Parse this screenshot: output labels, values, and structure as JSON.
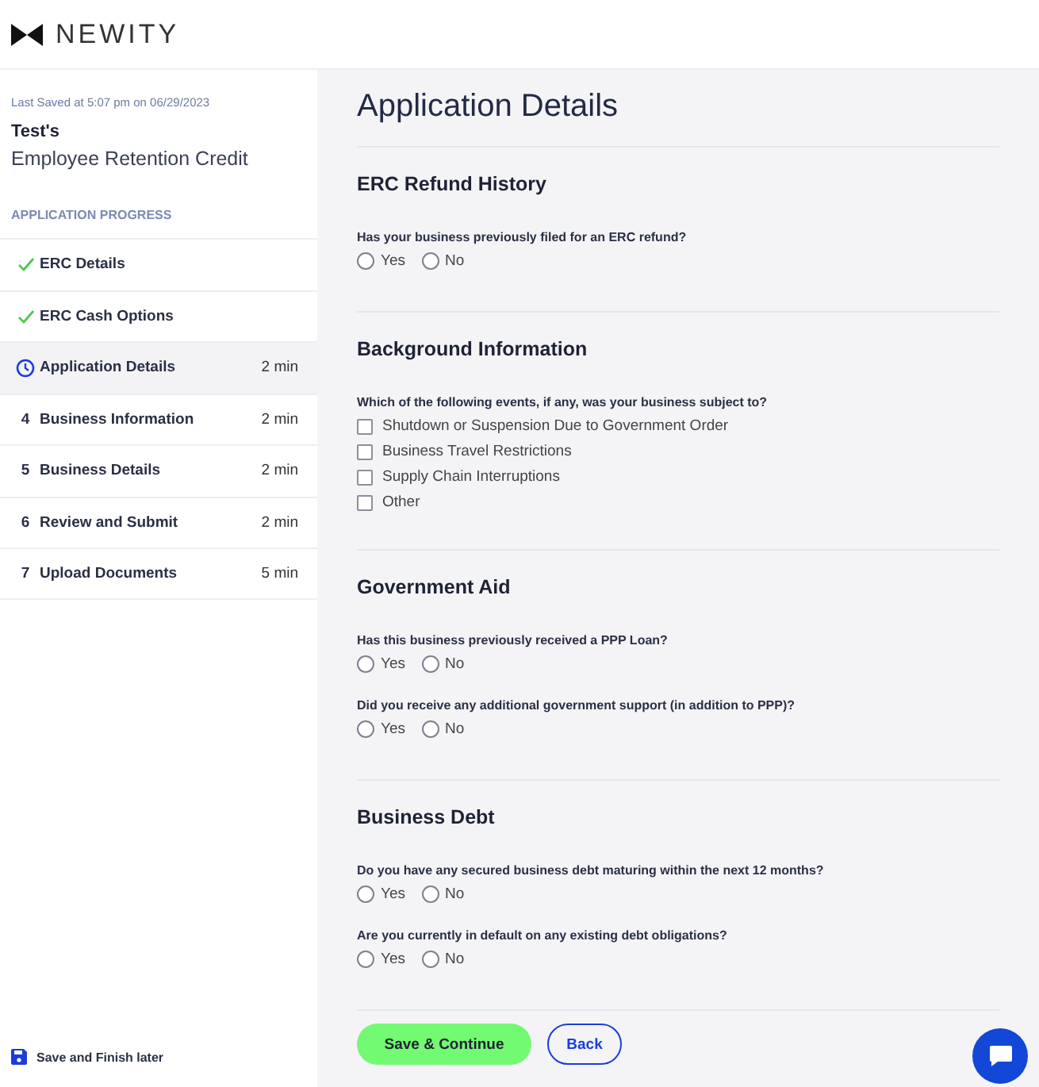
{
  "brand": "NEWITY",
  "sidebar": {
    "last_saved": "Last Saved at 5:07 pm on 06/29/2023",
    "owner": "Test's",
    "program": "Employee Retention Credit",
    "progress_heading": "APPLICATION PROGRESS",
    "steps": [
      {
        "kind": "done",
        "label": "ERC Details",
        "selected": false
      },
      {
        "kind": "done",
        "label": "ERC Cash Options",
        "selected": false
      },
      {
        "kind": "current",
        "label": "Application Details",
        "time": "2 min",
        "selected": true
      },
      {
        "kind": "todo",
        "number": "4",
        "label": "Business Information",
        "time": "2 min",
        "selected": false
      },
      {
        "kind": "todo",
        "number": "5",
        "label": "Business Details",
        "time": "2 min",
        "selected": false
      },
      {
        "kind": "todo",
        "number": "6",
        "label": "Review and Submit",
        "time": "2 min",
        "selected": false
      },
      {
        "kind": "todo",
        "number": "7",
        "label": "Upload Documents",
        "time": "5 min",
        "selected": false
      }
    ],
    "save_later": "Save and Finish later"
  },
  "page_title": "Application Details",
  "sections": [
    {
      "title": "ERC Refund History",
      "questions": [
        {
          "kind": "radio",
          "text": "Has your business previously filed for an ERC refund?",
          "options": [
            {
              "label": "Yes",
              "selected": false
            },
            {
              "label": "No",
              "selected": false
            }
          ]
        }
      ]
    },
    {
      "title": "Background Information",
      "questions": [
        {
          "kind": "checklist",
          "text": "Which of the following events, if any, was your business subject to?",
          "options": [
            {
              "label": "Shutdown or Suspension Due to Government Order",
              "checked": false
            },
            {
              "label": "Business Travel Restrictions",
              "checked": false
            },
            {
              "label": "Supply Chain Interruptions",
              "checked": false
            },
            {
              "label": "Other",
              "checked": false
            }
          ]
        }
      ]
    },
    {
      "title": "Government Aid",
      "questions": [
        {
          "kind": "radio",
          "text": "Has this business previously received a PPP Loan?",
          "options": [
            {
              "label": "Yes",
              "selected": false
            },
            {
              "label": "No",
              "selected": false
            }
          ]
        },
        {
          "kind": "radio",
          "text": "Did you receive any additional government support (in addition to PPP)?",
          "options": [
            {
              "label": "Yes",
              "selected": false
            },
            {
              "label": "No",
              "selected": false
            }
          ]
        }
      ]
    },
    {
      "title": "Business Debt",
      "questions": [
        {
          "kind": "radio",
          "text": "Do you have any secured business debt maturing within the next 12 months?",
          "options": [
            {
              "label": "Yes",
              "selected": false
            },
            {
              "label": "No",
              "selected": false
            }
          ]
        },
        {
          "kind": "radio",
          "text": "Are you currently in default on any existing debt obligations?",
          "options": [
            {
              "label": "Yes",
              "selected": false
            },
            {
              "label": "No",
              "selected": false
            }
          ]
        }
      ]
    }
  ],
  "buttons": {
    "primary": "Save & Continue",
    "secondary": "Back"
  }
}
